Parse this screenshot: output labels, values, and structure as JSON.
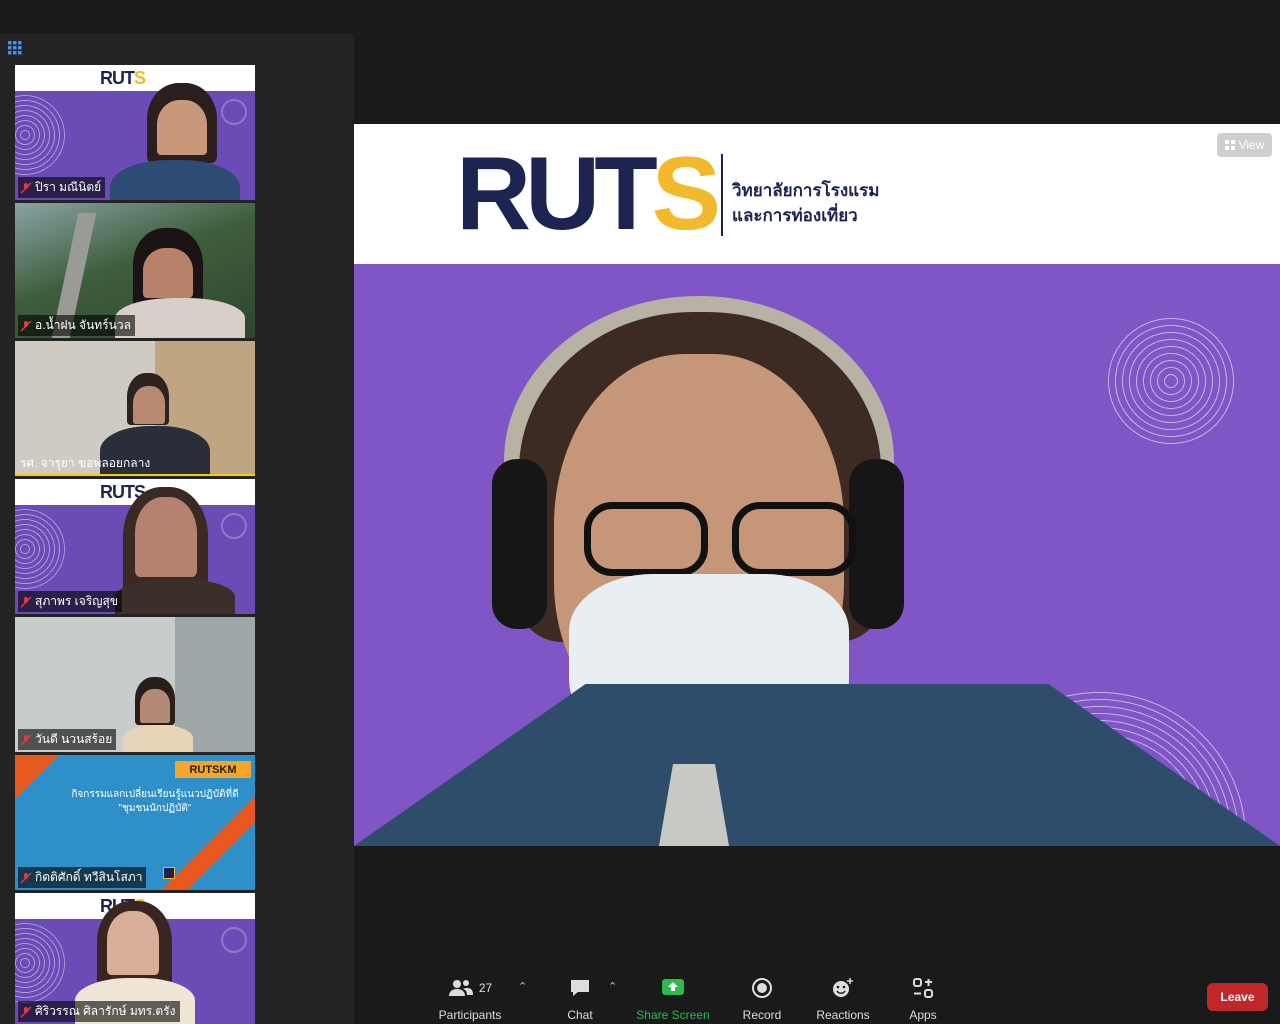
{
  "gallery": {
    "participants": [
      {
        "name": "ปิรา มณีนิตย์",
        "muted": true
      },
      {
        "name": "อ.น้ำฝน จันทร์นวล",
        "muted": true
      },
      {
        "name": "รศ. จารุยา ขอพลอยกลาง",
        "muted": false
      },
      {
        "name": "สุภาพร เจริญสุข",
        "muted": true
      },
      {
        "name": "วันดี นวนสร้อย",
        "muted": true
      },
      {
        "name": "กิตติศักดิ์ ทวีสินโสภา",
        "muted": true
      },
      {
        "name": "ศิริวรรณ ศิลารักษ์ มทร.ตรัง",
        "muted": true
      }
    ],
    "tile4_logo": "RUTS",
    "tile6_badge": "RUTSKM",
    "tile6_line1": "กิจกรรมแลกเปลี่ยนเรียนรู้แนวปฏิบัติที่ดี",
    "tile6_line2": "\"ชุมชนนักปฏิบัติ\""
  },
  "share": {
    "logo_main": "RUT",
    "logo_accent": "S",
    "org_line1": "วิทยาลัยการโรงแรม",
    "org_line2": "และการท่องเที่ยว",
    "view_label": "View"
  },
  "toolbar": {
    "participants_label": "Participants",
    "participants_count": "27",
    "chat_label": "Chat",
    "share_label": "Share Screen",
    "record_label": "Record",
    "reactions_label": "Reactions",
    "apps_label": "Apps",
    "leave_label": "Leave"
  },
  "colors": {
    "brand_navy": "#1e2452",
    "brand_yellow": "#f3b92c",
    "share_green": "#2fb84d",
    "leave_red": "#c0272b",
    "muted_red": "#e0393e"
  }
}
